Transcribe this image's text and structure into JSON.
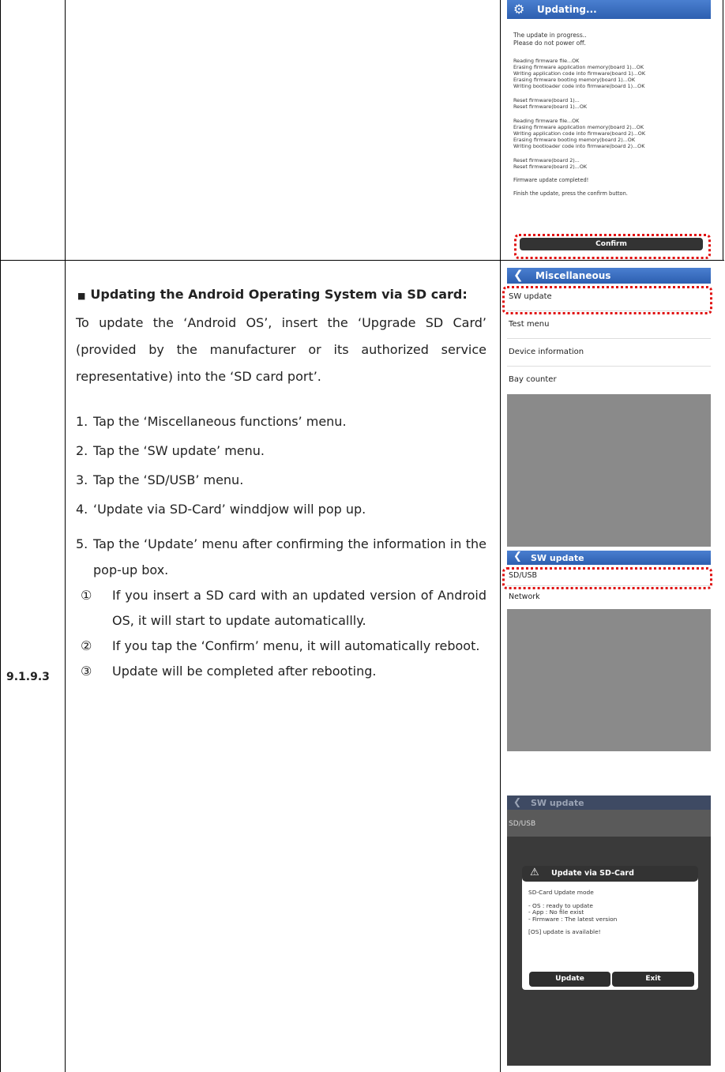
{
  "section": {
    "number": "9.1.9.3"
  },
  "text": {
    "heading_bullet": "■",
    "heading": "Updating the Android Operating System via SD card:",
    "intro": "To update the ‘Android OS’, insert the ‘Upgrade SD Card’ (provided by the manufacturer or its authorized service representative) into the ‘SD card port’.",
    "steps": [
      {
        "num": "1.",
        "text": "Tap the ‘Miscellaneous functions’ menu."
      },
      {
        "num": "2.",
        "text": "Tap the ‘SW update’ menu."
      },
      {
        "num": "3.",
        "text": "Tap the ‘SD/USB’ menu."
      },
      {
        "num": "4.",
        "text": "‘Update via SD-Card’ winddjow will pop up."
      },
      {
        "num": "5.",
        "text": "Tap the ‘Update’ menu after confirming the information in the pop-up box."
      }
    ],
    "substeps": [
      {
        "num": "①",
        "text": "If you insert a SD card with an updated version of Android OS, it will start to update automaticallly."
      },
      {
        "num": "②",
        "text": "If you tap the ‘Confirm’ menu, it will automatically reboot."
      },
      {
        "num": "③",
        "text": "Update will be completed after rebooting."
      }
    ]
  },
  "shot_updating": {
    "title": "Updating...",
    "icon": "gear-icon",
    "lines1": [
      "The update in progress..",
      "Please do not power off."
    ],
    "block1": [
      "Reading firmware file...OK",
      "Erasing firmware application memory(board 1)...OK",
      "Writing application code into firmware(board 1)...OK",
      "Erasing firmware booting memory(board 1)...OK",
      "Writing bootloader code into firmware(board 1)...OK"
    ],
    "block2": [
      "Reset firmware(board 1)...",
      "Reset firmware(board 1)...OK"
    ],
    "block3": [
      "Reading firmware file...OK",
      "Erasing firmware application memory(board 2)...OK",
      "Writing application code into firmware(board 2)...OK",
      "Erasing firmware booting memory(board 2)...OK",
      "Writing bootloader code into firmware(board 2)...OK"
    ],
    "block4": [
      "Reset firmware(board 2)...",
      "Reset firmware(board 2)...OK"
    ],
    "completed": "Firmware update completed!",
    "finish": "Finish the update, press the confirm button.",
    "confirm_label": "Confirm"
  },
  "shot_misc": {
    "title": "Miscellaneous",
    "items": [
      "SW update",
      "Test menu",
      "Device information",
      "Bay counter"
    ]
  },
  "shot_sw": {
    "title": "SW update",
    "items": [
      "SD/USB",
      "Network"
    ]
  },
  "shot_dialog": {
    "title": "SW update",
    "item": "SD/USB",
    "dialog_title": "Update via SD-Card",
    "mode": "SD-Card Update mode",
    "status": [
      "- OS : ready to update",
      "- App : No file exist",
      "- Firmware : The latest version"
    ],
    "available": "[OS] update is available!",
    "update_label": "Update",
    "exit_label": "Exit"
  },
  "colors": {
    "highlight": "#e01010",
    "titlebar": "#2d5fb0",
    "panel": "#8a8a8a"
  }
}
